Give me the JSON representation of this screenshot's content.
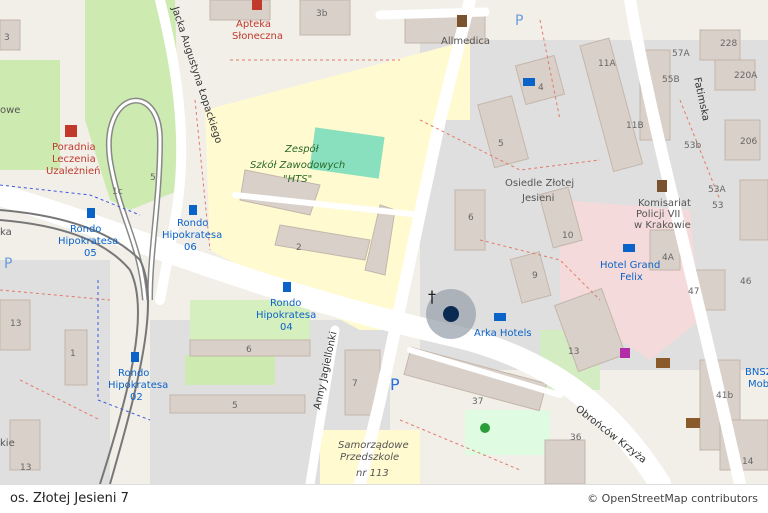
{
  "footer": {
    "title": "os. Złotej Jesieni 7",
    "attribution": "© OpenStreetMap contributors"
  },
  "marker": {
    "color": "#0b2a52",
    "ring_color": "#9aa3ad"
  },
  "labels": {
    "apteka": "Apteka",
    "apteka2": "Słoneczna",
    "allmedica": "Allmedica",
    "poradnia1": "Poradnia",
    "poradnia2": "Leczenia",
    "poradnia3": "Uzależnień",
    "school1": "Zespół",
    "school2": "Szkół Zawodowych",
    "school3": "\"HTS\"",
    "rondo_a1": "Rondo",
    "rondo_a2": "Hipokratesa",
    "rondo_a3": "05",
    "rondo_b1": "Rondo",
    "rondo_b2": "Hipokratesa",
    "rondo_b3": "06",
    "rondo_c1": "Rondo",
    "rondo_c2": "Hipokratesa",
    "rondo_c3": "04",
    "rondo_d1": "Rondo",
    "rondo_d2": "Hipokratesa",
    "rondo_d3": "02",
    "osiedle1": "Osiedle Złotej",
    "osiedle2": "Jesieni",
    "komisariat1": "Komisariat",
    "komisariat2": "Policji VII",
    "komisariat3": "w Krakowie",
    "hotel1": "Hotel Grand",
    "hotel2": "Felix",
    "arka": "Arka Hotels",
    "przedszkole1": "Samorządowe",
    "przedszkole2": "Przedszkole",
    "przedszkole3": "nr 113",
    "st_lopackiego": "Jacka Augustyna Łopackiego",
    "st_jagiellonki": "Anny Jagiellonki",
    "st_obroncow": "Obrońców Krzyża",
    "st_fatimska": "Fatimska",
    "bnsz1": "BNSZ",
    "bnsz2": "Mob",
    "owe": "owe",
    "kie": "kie",
    "ka": "ka",
    "p": "P"
  },
  "house_numbers": [
    "3b",
    "57A",
    "228",
    "11A",
    "55B",
    "220A",
    "4",
    "11B",
    "53b",
    "206",
    "5",
    "53A",
    "53",
    "6",
    "10",
    "4A",
    "47",
    "9",
    "46",
    "13",
    "41b",
    "37",
    "7",
    "36",
    "6",
    "5",
    "13",
    "1",
    "13",
    "1c",
    "2",
    "3",
    "14",
    "5"
  ]
}
